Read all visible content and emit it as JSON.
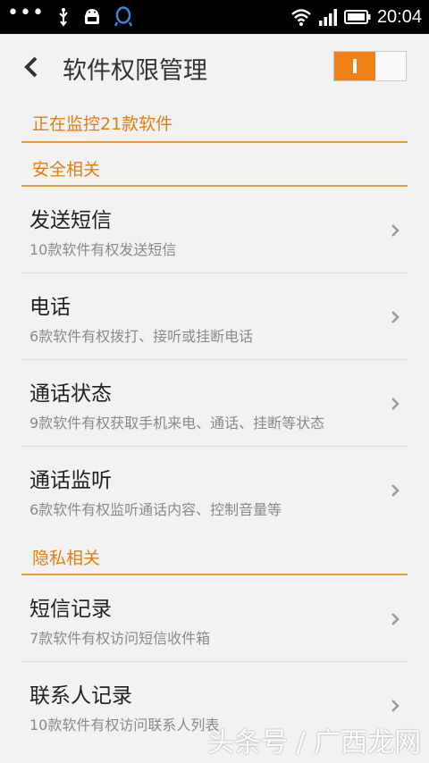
{
  "statusbar": {
    "time": "20:04",
    "icons": [
      "more-dots-icon",
      "usb-icon",
      "android-icon",
      "qq-icon",
      "wifi-icon",
      "signal-icon",
      "battery-icon"
    ]
  },
  "header": {
    "title": "软件权限管理",
    "toggle_on": true
  },
  "monitor_text": "正在监控21款软件",
  "sections": [
    {
      "label": "安全相关"
    },
    {
      "label": "隐私相关"
    }
  ],
  "rows": [
    {
      "title": "发送短信",
      "subtitle": "10款软件有权发送短信"
    },
    {
      "title": "电话",
      "subtitle": "6款软件有权拨打、接听或挂断电话"
    },
    {
      "title": "通话状态",
      "subtitle": "9款软件有权获取手机来电、通话、挂断等状态"
    },
    {
      "title": "通话监听",
      "subtitle": "6款软件有权监听通话内容、控制音量等"
    },
    {
      "title": "短信记录",
      "subtitle": "7款软件有权访问短信收件箱"
    },
    {
      "title": "联系人记录",
      "subtitle": "10款软件有权访问联系人列表"
    }
  ],
  "watermark": {
    "text": "头条号 / 广西龙网"
  },
  "colors": {
    "accent": "#ee8118",
    "background": "#f2f2f2"
  }
}
